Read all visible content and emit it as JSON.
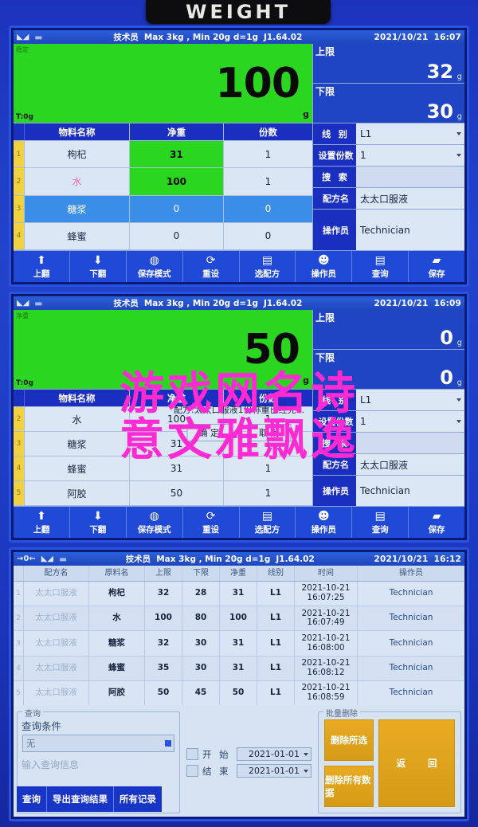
{
  "device_plate": {
    "label": "WEIGHT"
  },
  "common": {
    "operator_role": "技术员",
    "spec": "Max 3kg , Min 20g  d=1g",
    "version": "J1.64.02",
    "unit_g": "g",
    "zero_icon": "→0←",
    "stable_icon": "stable-icon"
  },
  "panel1": {
    "statusbar": {
      "role": "技术员",
      "spec": "Max 3kg , Min 20g  d=1g",
      "version": "J1.64.02",
      "date": "2021/10/21",
      "time": "16:07"
    },
    "display": {
      "value": "100",
      "unit": "g",
      "tare": "T:0g",
      "stable": "稳定"
    },
    "table": {
      "headers": [
        "物料名称",
        "净重",
        "份数"
      ],
      "rows": [
        {
          "idx": "1",
          "name": "枸杞",
          "net": "31",
          "count": "1"
        },
        {
          "idx": "2",
          "name": "水",
          "net": "100",
          "count": "1"
        },
        {
          "idx": "3",
          "name": "糖浆",
          "net": "0",
          "count": "0"
        },
        {
          "idx": "4",
          "name": "蜂蜜",
          "net": "0",
          "count": "0"
        }
      ]
    },
    "fields": {
      "upper_label": "上限",
      "upper_value": "32",
      "upper_unit": "g",
      "lower_label": "下限",
      "lower_value": "30",
      "lower_unit": "g",
      "line_label": "线 别",
      "line_value": "L1",
      "portion_label": "设置份数",
      "portion_value": "1",
      "search_label": "搜 索",
      "search_value": "",
      "recipe_label": "配方名",
      "recipe_value": "太太口服液",
      "operator_label": "操作员",
      "operator_value": "Technician"
    },
    "toolbar": [
      {
        "icon": "arrow-up-icon",
        "glyph": "⬆",
        "label": "上翻"
      },
      {
        "icon": "arrow-down-icon",
        "glyph": "⬇",
        "label": "下翻"
      },
      {
        "icon": "save-mode-icon",
        "glyph": "◍",
        "label": "保存模式"
      },
      {
        "icon": "reset-icon",
        "glyph": "⟳",
        "label": "重设"
      },
      {
        "icon": "recipe-icon",
        "glyph": "▤",
        "label": "选配方"
      },
      {
        "icon": "operator-icon",
        "glyph": "☻",
        "label": "操作员"
      },
      {
        "icon": "query-icon",
        "glyph": "🔍",
        "label": "查询"
      },
      {
        "icon": "save-icon",
        "glyph": "💾",
        "label": "保存"
      }
    ]
  },
  "panel2": {
    "statusbar": {
      "role": "技术员",
      "spec": "Max 3kg , Min 20g  d=1g",
      "version": "J1.64.02",
      "date": "2021/10/21",
      "time": "16:09"
    },
    "display": {
      "value": "50",
      "unit": "g",
      "tare": "T:0g",
      "stable": "净重"
    },
    "table": {
      "headers": [
        "物料名称",
        "净重",
        "份数"
      ],
      "rows": [
        {
          "idx": "2",
          "name": "水",
          "net": "100",
          "count": "1"
        },
        {
          "idx": "3",
          "name": "糖浆",
          "net": "31",
          "count": "1"
        },
        {
          "idx": "4",
          "name": "蜂蜜",
          "net": "31",
          "count": "1"
        },
        {
          "idx": "5",
          "name": "阿胶",
          "net": "50",
          "count": "1"
        }
      ]
    },
    "fields": {
      "upper_label": "上限",
      "upper_value": "0",
      "upper_unit": "g",
      "lower_label": "下限",
      "lower_value": "0",
      "lower_unit": "g",
      "line_label": "线 别",
      "line_value": "L1",
      "portion_label": "设置份数",
      "portion_value": "1",
      "search_label": "搜 索",
      "search_value": "",
      "recipe_label": "配方名",
      "recipe_value": "太太口服液",
      "operator_label": "操作员",
      "operator_value": "Technician"
    },
    "dialog": {
      "message": "配方:太太口服液1份称重已经完...",
      "ok": "确 定",
      "cancel": "取 消"
    },
    "toolbar": [
      {
        "icon": "arrow-up-icon",
        "glyph": "⬆",
        "label": "上翻"
      },
      {
        "icon": "arrow-down-icon",
        "glyph": "⬇",
        "label": "下翻"
      },
      {
        "icon": "save-mode-icon",
        "glyph": "◍",
        "label": "保存模式"
      },
      {
        "icon": "reset-icon",
        "glyph": "⟳",
        "label": "重设"
      },
      {
        "icon": "recipe-icon",
        "glyph": "▤",
        "label": "选配方"
      },
      {
        "icon": "operator-icon",
        "glyph": "☻",
        "label": "操作员"
      },
      {
        "icon": "query-icon",
        "glyph": "🔍",
        "label": "查询"
      },
      {
        "icon": "save-icon",
        "glyph": "💾",
        "label": "保存"
      }
    ]
  },
  "panel3": {
    "statusbar": {
      "zero": "→0←",
      "role": "技术员",
      "spec": "Max 3kg , Min 20g  d=1g",
      "version": "J1.64.02",
      "date": "2021/10/21",
      "time": "16:12"
    },
    "table": {
      "headers": [
        "配方名",
        "原料名",
        "上限",
        "下限",
        "净重",
        "线别",
        "时间",
        "操作员"
      ],
      "rows": [
        {
          "idx": "1",
          "recipe": "太太口服液",
          "material": "枸杞",
          "upper": "32",
          "lower": "28",
          "net": "31",
          "line": "L1",
          "date": "2021-10-21",
          "time": "16:07:25",
          "operator": "Technician"
        },
        {
          "idx": "2",
          "recipe": "太太口服液",
          "material": "水",
          "upper": "100",
          "lower": "80",
          "net": "100",
          "line": "L1",
          "date": "2021-10-21",
          "time": "16:07:49",
          "operator": "Technician"
        },
        {
          "idx": "3",
          "recipe": "太太口服液",
          "material": "糖浆",
          "upper": "32",
          "lower": "30",
          "net": "31",
          "line": "L1",
          "date": "2021-10-21",
          "time": "16:08:00",
          "operator": "Technician"
        },
        {
          "idx": "4",
          "recipe": "太太口服液",
          "material": "蜂蜜",
          "upper": "35",
          "lower": "30",
          "net": "31",
          "line": "L1",
          "date": "2021-10-21",
          "time": "16:08:12",
          "operator": "Technician"
        },
        {
          "idx": "5",
          "recipe": "太太口服液",
          "material": "阿胶",
          "upper": "50",
          "lower": "45",
          "net": "50",
          "line": "L1",
          "date": "2021-10-21",
          "time": "16:08:59",
          "operator": "Technician"
        }
      ]
    },
    "query": {
      "group_label": "查询",
      "condition_label": "查询条件",
      "condition_value": "无",
      "input_placeholder": "输入查询信息",
      "start_label": "开 始",
      "start_value": "2021-01-01",
      "end_label": "结 束",
      "end_value": "2021-01-01",
      "btn_query": "查询",
      "btn_export": "导出查询结果",
      "btn_all": "所有记录"
    },
    "batch": {
      "group_label": "批量删除",
      "btn_delete_selected": "删除所选",
      "btn_delete_all": "删除所有数据",
      "btn_return": "返 回"
    }
  },
  "watermark": {
    "line1": "游戏网名诗",
    "line2": "意文雅飘逸",
    "color": "#ff2ad4"
  }
}
